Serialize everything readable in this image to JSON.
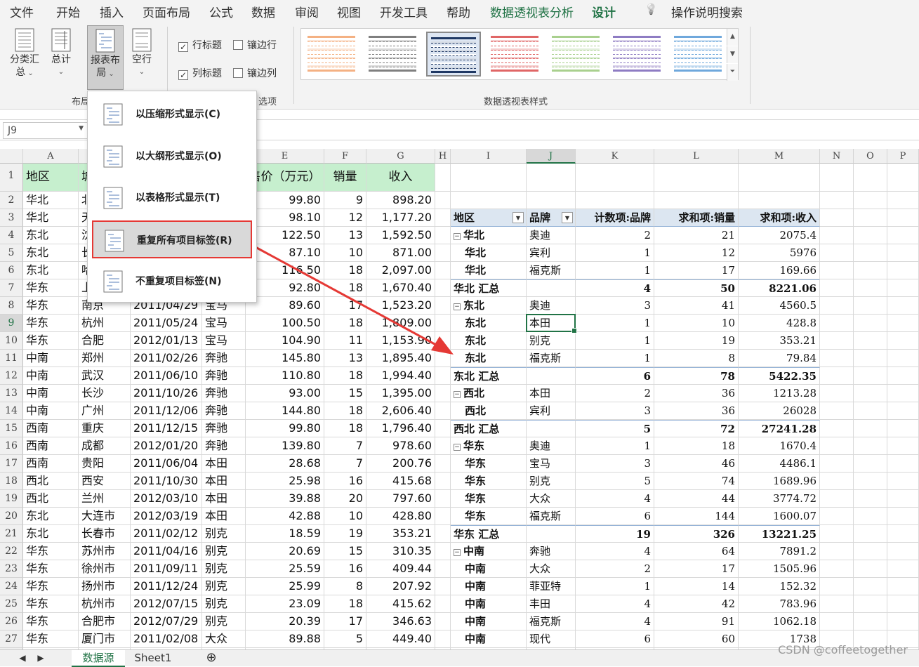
{
  "menu_tabs": [
    "文件",
    "开始",
    "插入",
    "页面布局",
    "公式",
    "数据",
    "审阅",
    "视图",
    "开发工具",
    "帮助",
    "数据透视表分析",
    "设计",
    "操作说明搜索"
  ],
  "ribbon": {
    "subtotal": [
      "分类汇",
      "总"
    ],
    "grand_total": "总计",
    "report_layout": [
      "报表布",
      "局"
    ],
    "blank_rows": "空行",
    "group_layout": "布局",
    "row_headers": "行标题",
    "col_headers": "列标题",
    "banded_rows": "镶边行",
    "banded_cols": "镶边列",
    "group_options": "选项",
    "group_styles": "数据透视表样式"
  },
  "name_box": "J9",
  "dropdown_items": [
    "以压缩形式显示(C)",
    "以大纲形式显示(O)",
    "以表格形式显示(T)",
    "重复所有项目标签(R)",
    "不重复项目标签(N)"
  ],
  "columns": [
    "A",
    "",
    "",
    "",
    "E",
    "F",
    "G",
    "H",
    "I",
    "J",
    "K",
    "L",
    "M",
    "N",
    "O",
    "P"
  ],
  "source": {
    "headers": [
      "地区",
      "城",
      "",
      "",
      "售价（万元）",
      "销量",
      "收入"
    ],
    "rows": [
      [
        "华北",
        "北",
        "",
        "",
        "99.80",
        "9",
        "898.20"
      ],
      [
        "华北",
        "天",
        "",
        "",
        "98.10",
        "12",
        "1,177.20"
      ],
      [
        "东北",
        "沈",
        "",
        "",
        "122.50",
        "13",
        "1,592.50"
      ],
      [
        "东北",
        "长",
        "",
        "",
        "87.10",
        "10",
        "871.00"
      ],
      [
        "东北",
        "哈",
        "",
        "",
        "116.50",
        "18",
        "2,097.00"
      ],
      [
        "华东",
        "上",
        "",
        "",
        "92.80",
        "18",
        "1,670.40"
      ],
      [
        "华东",
        "南京",
        "2011/04/29",
        "宝马",
        "89.60",
        "17",
        "1,523.20"
      ],
      [
        "华东",
        "杭州",
        "2011/05/24",
        "宝马",
        "100.50",
        "18",
        "1,809.00"
      ],
      [
        "华东",
        "合肥",
        "2012/01/13",
        "宝马",
        "104.90",
        "11",
        "1,153.90"
      ],
      [
        "中南",
        "郑州",
        "2011/02/26",
        "奔驰",
        "145.80",
        "13",
        "1,895.40"
      ],
      [
        "中南",
        "武汉",
        "2011/06/10",
        "奔驰",
        "110.80",
        "18",
        "1,994.40"
      ],
      [
        "中南",
        "长沙",
        "2011/10/26",
        "奔驰",
        "93.00",
        "15",
        "1,395.00"
      ],
      [
        "中南",
        "广州",
        "2011/12/06",
        "奔驰",
        "144.80",
        "18",
        "2,606.40"
      ],
      [
        "西南",
        "重庆",
        "2011/12/15",
        "奔驰",
        "99.80",
        "18",
        "1,796.40"
      ],
      [
        "西南",
        "成都",
        "2012/01/20",
        "奔驰",
        "139.80",
        "7",
        "978.60"
      ],
      [
        "西南",
        "贵阳",
        "2011/06/04",
        "本田",
        "28.68",
        "7",
        "200.76"
      ],
      [
        "西北",
        "西安",
        "2011/10/30",
        "本田",
        "25.98",
        "16",
        "415.68"
      ],
      [
        "西北",
        "兰州",
        "2012/03/10",
        "本田",
        "39.88",
        "20",
        "797.60"
      ],
      [
        "东北",
        "大连市",
        "2012/03/19",
        "本田",
        "42.88",
        "10",
        "428.80"
      ],
      [
        "东北",
        "长春市",
        "2011/02/12",
        "别克",
        "18.59",
        "19",
        "353.21"
      ],
      [
        "华东",
        "苏州市",
        "2011/04/16",
        "别克",
        "20.69",
        "15",
        "310.35"
      ],
      [
        "华东",
        "徐州市",
        "2011/09/11",
        "别克",
        "25.59",
        "16",
        "409.44"
      ],
      [
        "华东",
        "扬州市",
        "2011/12/24",
        "别克",
        "25.99",
        "8",
        "207.92"
      ],
      [
        "华东",
        "杭州市",
        "2012/07/15",
        "别克",
        "23.09",
        "18",
        "415.62"
      ],
      [
        "华东",
        "合肥市",
        "2012/07/29",
        "别克",
        "20.39",
        "17",
        "346.63"
      ],
      [
        "华东",
        "厦门市",
        "2011/02/08",
        "大众",
        "89.88",
        "5",
        "449.40"
      ]
    ]
  },
  "pivot": {
    "headers": [
      "地区",
      "品牌",
      "计数项:品牌",
      "求和项:销量",
      "求和项:收入"
    ],
    "rows": [
      [
        "g",
        "华北",
        "奥迪",
        "2",
        "21",
        "2075.4"
      ],
      [
        "",
        "华北",
        "宾利",
        "1",
        "12",
        "5976"
      ],
      [
        "",
        "华北",
        "福克斯",
        "1",
        "17",
        "169.66"
      ],
      [
        "t",
        "华北 汇总",
        "",
        "4",
        "50",
        "8221.06"
      ],
      [
        "g",
        "东北",
        "奥迪",
        "3",
        "41",
        "4560.5"
      ],
      [
        "",
        "东北",
        "本田",
        "1",
        "10",
        "428.8"
      ],
      [
        "",
        "东北",
        "别克",
        "1",
        "19",
        "353.21"
      ],
      [
        "",
        "东北",
        "福克斯",
        "1",
        "8",
        "79.84"
      ],
      [
        "t",
        "东北 汇总",
        "",
        "6",
        "78",
        "5422.35"
      ],
      [
        "g",
        "西北",
        "本田",
        "2",
        "36",
        "1213.28"
      ],
      [
        "",
        "西北",
        "宾利",
        "3",
        "36",
        "26028"
      ],
      [
        "t",
        "西北 汇总",
        "",
        "5",
        "72",
        "27241.28"
      ],
      [
        "g",
        "华东",
        "奥迪",
        "1",
        "18",
        "1670.4"
      ],
      [
        "",
        "华东",
        "宝马",
        "3",
        "46",
        "4486.1"
      ],
      [
        "",
        "华东",
        "别克",
        "5",
        "74",
        "1689.96"
      ],
      [
        "",
        "华东",
        "大众",
        "4",
        "44",
        "3774.72"
      ],
      [
        "",
        "华东",
        "福克斯",
        "6",
        "144",
        "1600.07"
      ],
      [
        "t",
        "华东 汇总",
        "",
        "19",
        "326",
        "13221.25"
      ],
      [
        "g",
        "中南",
        "奔驰",
        "4",
        "64",
        "7891.2"
      ],
      [
        "",
        "中南",
        "大众",
        "2",
        "17",
        "1505.96"
      ],
      [
        "",
        "中南",
        "菲亚特",
        "1",
        "14",
        "152.32"
      ],
      [
        "",
        "中南",
        "丰田",
        "4",
        "42",
        "783.96"
      ],
      [
        "",
        "中南",
        "福克斯",
        "4",
        "91",
        "1062.18"
      ],
      [
        "",
        "中南",
        "现代",
        "6",
        "60",
        "1738"
      ]
    ]
  },
  "sheet_tabs": [
    "数据源",
    "Sheet1"
  ],
  "watermark": "CSDN @coffeetogether",
  "colors": {
    "accent": "#217346",
    "pivot_header": "#dce6f1",
    "source_header": "#c6efce",
    "highlight": "#e53935"
  }
}
